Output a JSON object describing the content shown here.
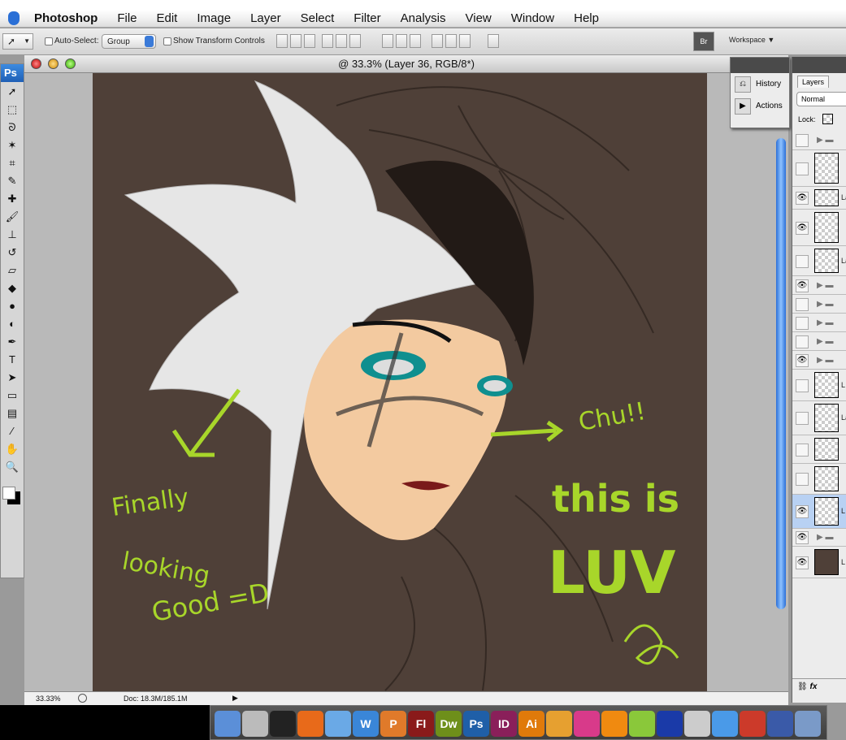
{
  "menubar": {
    "app": "Photoshop",
    "items": [
      "File",
      "Edit",
      "Image",
      "Layer",
      "Select",
      "Filter",
      "Analysis",
      "View",
      "Window",
      "Help"
    ]
  },
  "options": {
    "auto_select_label": "Auto-Select:",
    "auto_select_value": "Group",
    "show_transform_label": "Show Transform Controls",
    "workspace_label": "Workspace ▼",
    "bridge_icon": "Br"
  },
  "toolbox": {
    "logo": "Ps",
    "tools": [
      "move",
      "marquee",
      "lasso",
      "magic-wand",
      "crop",
      "slice",
      "healing",
      "brush",
      "stamp",
      "history-brush",
      "eraser",
      "paint-bucket",
      "dodge",
      "burn",
      "pen",
      "type",
      "path-select",
      "shape",
      "notes",
      "eyedropper",
      "hand",
      "zoom"
    ]
  },
  "document": {
    "title": "@ 33.3% (Layer 36, RGB/8*)",
    "zoom": "33.33%",
    "doc_size": "Doc: 18.3M/185.1M",
    "canvas_bg": "#4f4038"
  },
  "artwork": {
    "text_finally": "Finally",
    "text_looking": "looking",
    "text_good": "Good =D",
    "text_chu": "Chu!!",
    "text_this_is": "this is",
    "text_luv": "LUV",
    "accent": "#a8d62a"
  },
  "history_panel": {
    "items": [
      {
        "label": "History",
        "icon": "history-icon"
      },
      {
        "label": "Actions",
        "icon": "actions-icon"
      }
    ]
  },
  "layers_panel": {
    "tab": "Layers",
    "blend_mode": "Normal",
    "lock_label": "Lock:",
    "rows": [
      {
        "type": "group",
        "visible": false
      },
      {
        "type": "layer",
        "visible": false,
        "name": ""
      },
      {
        "type": "layer",
        "visible": true,
        "name": "Lay"
      },
      {
        "type": "layer",
        "visible": true,
        "name": ""
      },
      {
        "type": "layer",
        "visible": false,
        "name": "La"
      },
      {
        "type": "group",
        "visible": true
      },
      {
        "type": "group",
        "visible": false
      },
      {
        "type": "group",
        "visible": false
      },
      {
        "type": "group",
        "visible": false
      },
      {
        "type": "group",
        "visible": true
      },
      {
        "type": "layer",
        "visible": false,
        "name": "L"
      },
      {
        "type": "layer",
        "visible": false,
        "name": "La"
      },
      {
        "type": "layer",
        "visible": false,
        "name": ""
      },
      {
        "type": "layer",
        "visible": false,
        "name": ""
      },
      {
        "type": "layer",
        "visible": true,
        "name": "L",
        "selected": true
      },
      {
        "type": "group",
        "visible": true
      },
      {
        "type": "layer",
        "visible": true,
        "name": "L",
        "fill": "#4f4038"
      }
    ]
  },
  "dock": {
    "apps": [
      {
        "name": "finder",
        "label": "",
        "color": "#5b8fd8"
      },
      {
        "name": "apple",
        "label": "",
        "color": "#bbbbbb"
      },
      {
        "name": "dashboard",
        "label": "",
        "color": "#222222"
      },
      {
        "name": "firefox",
        "label": "",
        "color": "#e86a1a"
      },
      {
        "name": "itunes",
        "label": "",
        "color": "#6aa9e6"
      },
      {
        "name": "word",
        "label": "W",
        "color": "#3a86d8"
      },
      {
        "name": "powerpoint",
        "label": "P",
        "color": "#e07a2a"
      },
      {
        "name": "flash",
        "label": "Fl",
        "color": "#8a1a1a"
      },
      {
        "name": "dreamweaver",
        "label": "Dw",
        "color": "#6e8f1a"
      },
      {
        "name": "photoshop",
        "label": "Ps",
        "color": "#1f5fa8"
      },
      {
        "name": "indesign",
        "label": "ID",
        "color": "#8a1f5a"
      },
      {
        "name": "illustrator",
        "label": "Ai",
        "color": "#e07a0a"
      },
      {
        "name": "pages",
        "label": "",
        "color": "#e6a030"
      },
      {
        "name": "flower",
        "label": "",
        "color": "#d83a8a"
      },
      {
        "name": "vlc",
        "label": "",
        "color": "#f08a10"
      },
      {
        "name": "limewire",
        "label": "",
        "color": "#8ac83a"
      },
      {
        "name": "frog",
        "label": "",
        "color": "#1a3aa8"
      },
      {
        "name": "printer",
        "label": "",
        "color": "#cccccc"
      },
      {
        "name": "messenger",
        "label": "",
        "color": "#4a9ae8"
      },
      {
        "name": "rocket",
        "label": "",
        "color": "#cc3a2a"
      },
      {
        "name": "brush",
        "label": "",
        "color": "#3a5aa8"
      },
      {
        "name": "preview",
        "label": "",
        "color": "#7a9ac8"
      }
    ]
  }
}
